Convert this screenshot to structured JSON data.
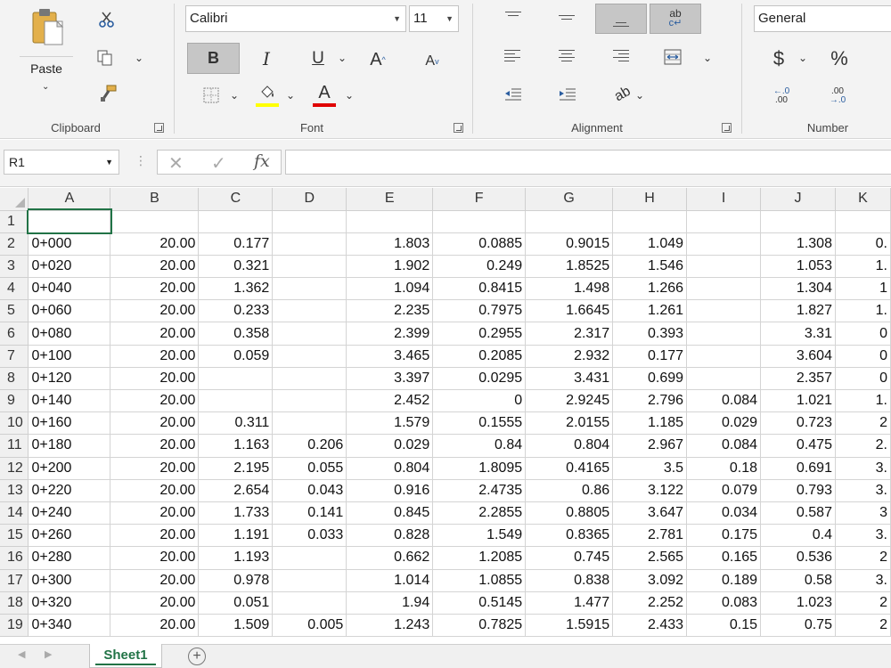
{
  "ribbon": {
    "clipboard": {
      "label": "Clipboard",
      "paste_label": "Paste"
    },
    "font": {
      "label": "Font",
      "font_name": "Calibri",
      "font_size": "11",
      "bold": "B",
      "italic": "I",
      "underline": "U",
      "grow": "A",
      "shrink": "A",
      "font_color_letter": "A",
      "highlight_color": "#ffff00",
      "font_color": "#e00000"
    },
    "alignment": {
      "label": "Alignment",
      "wrap_text_glyph": "ab"
    },
    "number": {
      "label": "Number",
      "format": "General",
      "currency": "$",
      "percent": "%",
      "inc_decimal_top": "←.0",
      "inc_decimal_bottom": ".00",
      "dec_decimal_top": ".00",
      "dec_decimal_bottom": "→.0"
    }
  },
  "formula_bar": {
    "name_box": "R1",
    "fx": "fx",
    "formula": ""
  },
  "grid": {
    "columns": [
      "A",
      "B",
      "C",
      "D",
      "E",
      "F",
      "G",
      "H",
      "I",
      "J",
      "K"
    ],
    "rows": [
      {
        "n": "1",
        "cells": [
          "",
          "",
          "",
          "",
          "",
          "",
          "",
          "",
          "",
          "",
          ""
        ]
      },
      {
        "n": "2",
        "cells": [
          "0+000",
          "20.00",
          "0.177",
          "",
          "1.803",
          "0.0885",
          "0.9015",
          "1.049",
          "",
          "1.308",
          "0."
        ]
      },
      {
        "n": "3",
        "cells": [
          "0+020",
          "20.00",
          "0.321",
          "",
          "1.902",
          "0.249",
          "1.8525",
          "1.546",
          "",
          "1.053",
          "1."
        ]
      },
      {
        "n": "4",
        "cells": [
          "0+040",
          "20.00",
          "1.362",
          "",
          "1.094",
          "0.8415",
          "1.498",
          "1.266",
          "",
          "1.304",
          "1"
        ]
      },
      {
        "n": "5",
        "cells": [
          "0+060",
          "20.00",
          "0.233",
          "",
          "2.235",
          "0.7975",
          "1.6645",
          "1.261",
          "",
          "1.827",
          "1."
        ]
      },
      {
        "n": "6",
        "cells": [
          "0+080",
          "20.00",
          "0.358",
          "",
          "2.399",
          "0.2955",
          "2.317",
          "0.393",
          "",
          "3.31",
          "0"
        ]
      },
      {
        "n": "7",
        "cells": [
          "0+100",
          "20.00",
          "0.059",
          "",
          "3.465",
          "0.2085",
          "2.932",
          "0.177",
          "",
          "3.604",
          "0"
        ]
      },
      {
        "n": "8",
        "cells": [
          "0+120",
          "20.00",
          "",
          "",
          "3.397",
          "0.0295",
          "3.431",
          "0.699",
          "",
          "2.357",
          "0"
        ]
      },
      {
        "n": "9",
        "cells": [
          "0+140",
          "20.00",
          "",
          "",
          "2.452",
          "0",
          "2.9245",
          "2.796",
          "0.084",
          "1.021",
          "1."
        ]
      },
      {
        "n": "10",
        "cells": [
          "0+160",
          "20.00",
          "0.311",
          "",
          "1.579",
          "0.1555",
          "2.0155",
          "1.185",
          "0.029",
          "0.723",
          "2"
        ]
      },
      {
        "n": "11",
        "cells": [
          "0+180",
          "20.00",
          "1.163",
          "0.206",
          "0.029",
          "0.84",
          "0.804",
          "2.967",
          "0.084",
          "0.475",
          "2."
        ]
      },
      {
        "n": "12",
        "cells": [
          "0+200",
          "20.00",
          "2.195",
          "0.055",
          "0.804",
          "1.8095",
          "0.4165",
          "3.5",
          "0.18",
          "0.691",
          "3."
        ]
      },
      {
        "n": "13",
        "cells": [
          "0+220",
          "20.00",
          "2.654",
          "0.043",
          "0.916",
          "2.4735",
          "0.86",
          "3.122",
          "0.079",
          "0.793",
          "3."
        ]
      },
      {
        "n": "14",
        "cells": [
          "0+240",
          "20.00",
          "1.733",
          "0.141",
          "0.845",
          "2.2855",
          "0.8805",
          "3.647",
          "0.034",
          "0.587",
          "3"
        ]
      },
      {
        "n": "15",
        "cells": [
          "0+260",
          "20.00",
          "1.191",
          "0.033",
          "0.828",
          "1.549",
          "0.8365",
          "2.781",
          "0.175",
          "0.4",
          "3."
        ]
      },
      {
        "n": "16",
        "cells": [
          "0+280",
          "20.00",
          "1.193",
          "",
          "0.662",
          "1.2085",
          "0.745",
          "2.565",
          "0.165",
          "0.536",
          "2"
        ]
      },
      {
        "n": "17",
        "cells": [
          "0+300",
          "20.00",
          "0.978",
          "",
          "1.014",
          "1.0855",
          "0.838",
          "3.092",
          "0.189",
          "0.58",
          "3."
        ]
      },
      {
        "n": "18",
        "cells": [
          "0+320",
          "20.00",
          "0.051",
          "",
          "1.94",
          "0.5145",
          "1.477",
          "2.252",
          "0.083",
          "1.023",
          "2"
        ]
      },
      {
        "n": "19",
        "cells": [
          "0+340",
          "20.00",
          "1.509",
          "0.005",
          "1.243",
          "0.7825",
          "1.5915",
          "2.433",
          "0.15",
          "0.75",
          "2"
        ]
      }
    ]
  },
  "sheet_tabs": {
    "active": "Sheet1"
  }
}
